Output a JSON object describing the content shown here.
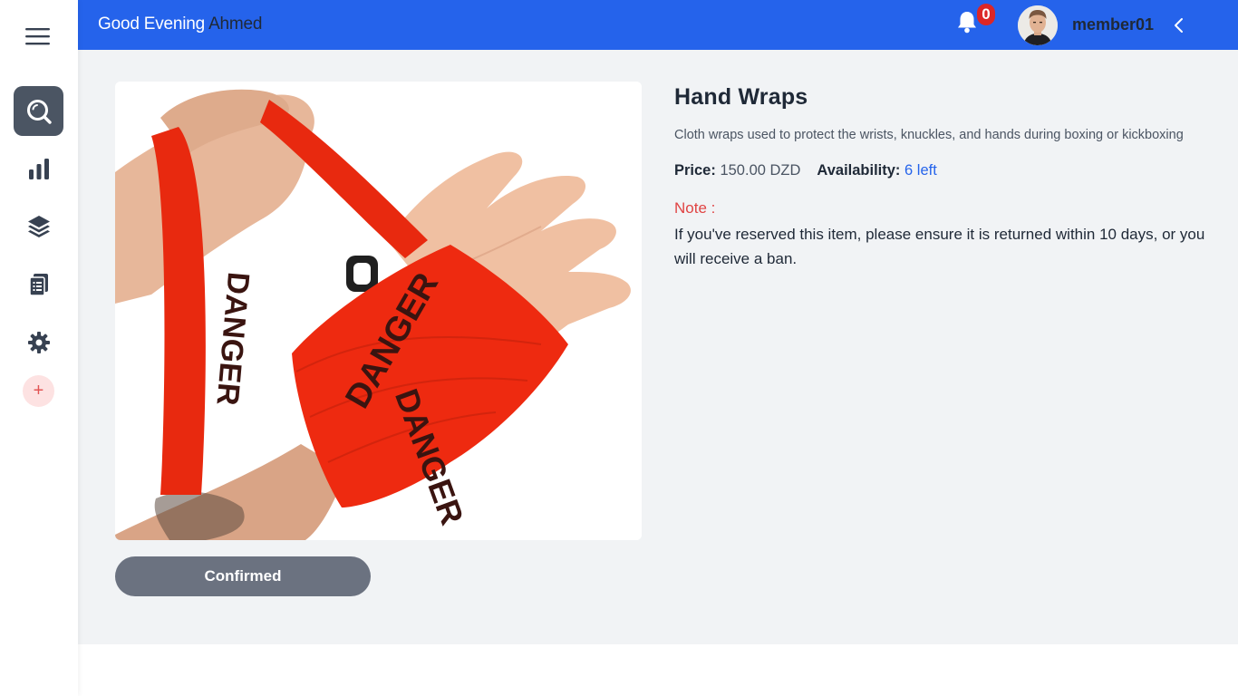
{
  "header": {
    "greeting": "Good Evening",
    "user_first_name": "Ahmed",
    "notification_count": "0",
    "username": "member01"
  },
  "sidebar": {
    "items": [
      {
        "icon": "search-icon",
        "active": true
      },
      {
        "icon": "bar-chart-icon",
        "active": false
      },
      {
        "icon": "layers-icon",
        "active": false
      },
      {
        "icon": "clipboard-icon",
        "active": false
      },
      {
        "icon": "gear-icon",
        "active": false
      }
    ],
    "add_label": "+"
  },
  "product": {
    "name": "Hand Wraps",
    "description": "Cloth wraps used to protect the wrists, knuckles, and hands during boxing or kickboxing",
    "price_label": "Price:",
    "price_value": "150.00 DZD",
    "availability_label": "Availability:",
    "availability_value": "6 left",
    "note_label": "Note :",
    "note_text": "If you've reserved this item, please ensure it is returned within 10 days, or you will receive a ban.",
    "image_text": "DANGER"
  },
  "actions": {
    "status_button": "Confirmed"
  },
  "colors": {
    "header": "#2563eb",
    "sidebar_active": "#4b5563",
    "background": "#f1f3f5",
    "availability": "#2563eb",
    "note": "#e04444",
    "badge": "#dc2626",
    "button": "#6b7280"
  }
}
